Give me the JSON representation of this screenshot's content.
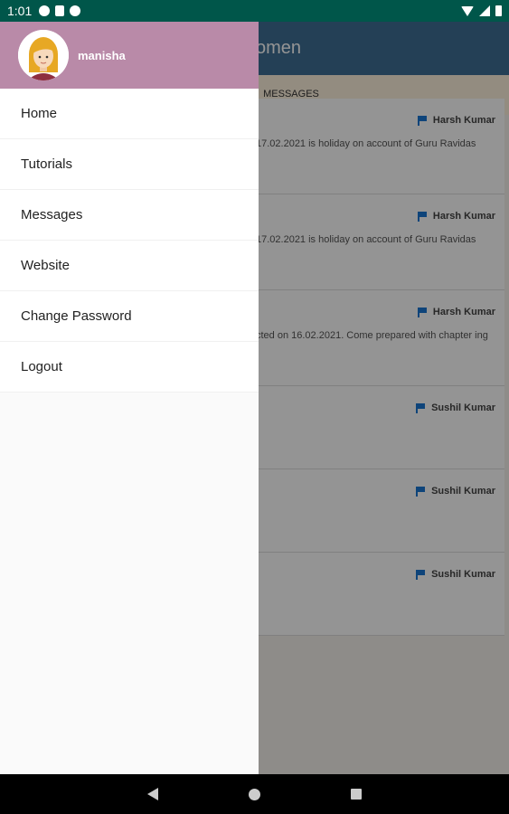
{
  "status_bar": {
    "time": "1:01"
  },
  "app": {
    "title": "omen",
    "tab_messages": "MESSAGES",
    "messages": [
      {
        "sender": "Harsh Kumar",
        "text": "17.02.2021 is holiday on account of Guru Ravidas"
      },
      {
        "sender": "Harsh Kumar",
        "text": "17.02.2021 is holiday on account of Guru Ravidas"
      },
      {
        "sender": "Harsh Kumar",
        "text": "cted on 16.02.2021. Come prepared with chapter ing"
      },
      {
        "sender": "Sushil Kumar",
        "text": ""
      },
      {
        "sender": "Sushil Kumar",
        "text": ""
      },
      {
        "sender": "Sushil Kumar",
        "text": ""
      }
    ]
  },
  "drawer": {
    "username": "manisha",
    "menu": [
      {
        "label": "Home"
      },
      {
        "label": "Tutorials"
      },
      {
        "label": "Messages"
      },
      {
        "label": "Website"
      },
      {
        "label": "Change Password"
      },
      {
        "label": "Logout"
      }
    ]
  },
  "colors": {
    "status_bar": "#00564a",
    "app_bar": "#3f6f94",
    "drawer_header": "#b98aa8",
    "flag_icon": "#1976d2"
  }
}
